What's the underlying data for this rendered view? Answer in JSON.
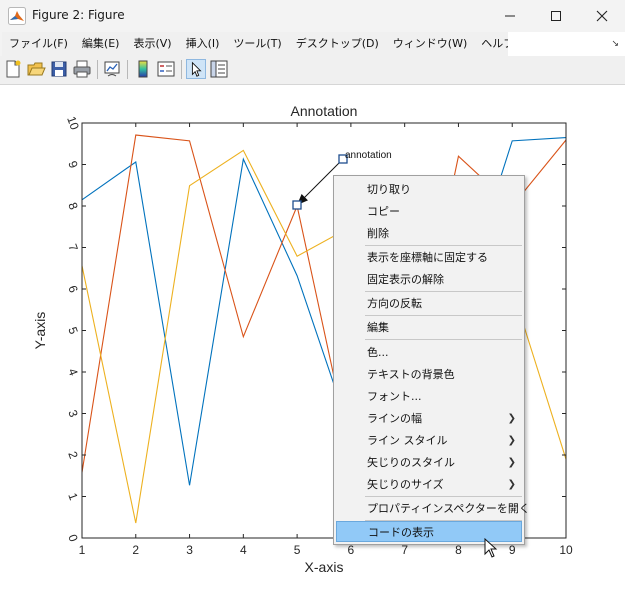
{
  "window": {
    "title": "Figure 2: Figure"
  },
  "menu": [
    "ファイル(F)",
    "編集(E)",
    "表示(V)",
    "挿入(I)",
    "ツール(T)",
    "デスクトップ(D)",
    "ウィンドウ(W)",
    "ヘルプ(H)"
  ],
  "toolbar": {
    "icons": [
      "new-figure-icon",
      "open-file-icon",
      "save-icon",
      "print-icon",
      "link-plot-icon",
      "colorbar-icon",
      "legend-icon",
      "edit-plot-icon",
      "property-inspector-icon"
    ]
  },
  "annotation": {
    "text": "annotation"
  },
  "context_menu": {
    "items": [
      {
        "label": "切り取り"
      },
      {
        "label": "コピー"
      },
      {
        "label": "削除"
      },
      {
        "label": "表示を座標軸に固定する"
      },
      {
        "label": "固定表示の解除"
      },
      {
        "label": "方向の反転"
      },
      {
        "label": "編集"
      },
      {
        "label": "色..."
      },
      {
        "label": "テキストの背景色"
      },
      {
        "label": "フォント..."
      },
      {
        "label": "ラインの幅"
      },
      {
        "label": "ライン スタイル"
      },
      {
        "label": "矢じりのスタイル"
      },
      {
        "label": "矢じりのサイズ"
      },
      {
        "label": "プロパティインスペクターを開く"
      },
      {
        "label": "コードの表示"
      }
    ]
  },
  "chart_data": {
    "type": "line",
    "title": "Annotation",
    "xlabel": "X-axis",
    "ylabel": "Y-axis",
    "xlim": [
      1,
      10
    ],
    "ylim": [
      0,
      10
    ],
    "xticks": [
      "1",
      "2",
      "3",
      "4",
      "5",
      "6",
      "7",
      "8",
      "9",
      "10"
    ],
    "yticks": [
      "0",
      "1",
      "2",
      "3",
      "4",
      "5",
      "6",
      "7",
      "8",
      "9",
      "10"
    ],
    "grid": false,
    "x": [
      1,
      2,
      3,
      4,
      5,
      6,
      7,
      8,
      9,
      10
    ],
    "series": [
      {
        "color": "#0072BD",
        "values": [
          8.15,
          9.06,
          1.27,
          9.13,
          6.32,
          2.5,
          2.8,
          5.5,
          9.57,
          9.65
        ]
      },
      {
        "color": "#D95319",
        "values": [
          1.58,
          9.71,
          9.57,
          4.85,
          8.0,
          2.0,
          3.0,
          9.2,
          8.0,
          9.59
        ]
      },
      {
        "color": "#EDB120",
        "values": [
          6.56,
          0.36,
          8.49,
          9.34,
          6.79,
          7.5,
          7.5,
          7.5,
          6.0,
          1.9
        ]
      }
    ]
  }
}
